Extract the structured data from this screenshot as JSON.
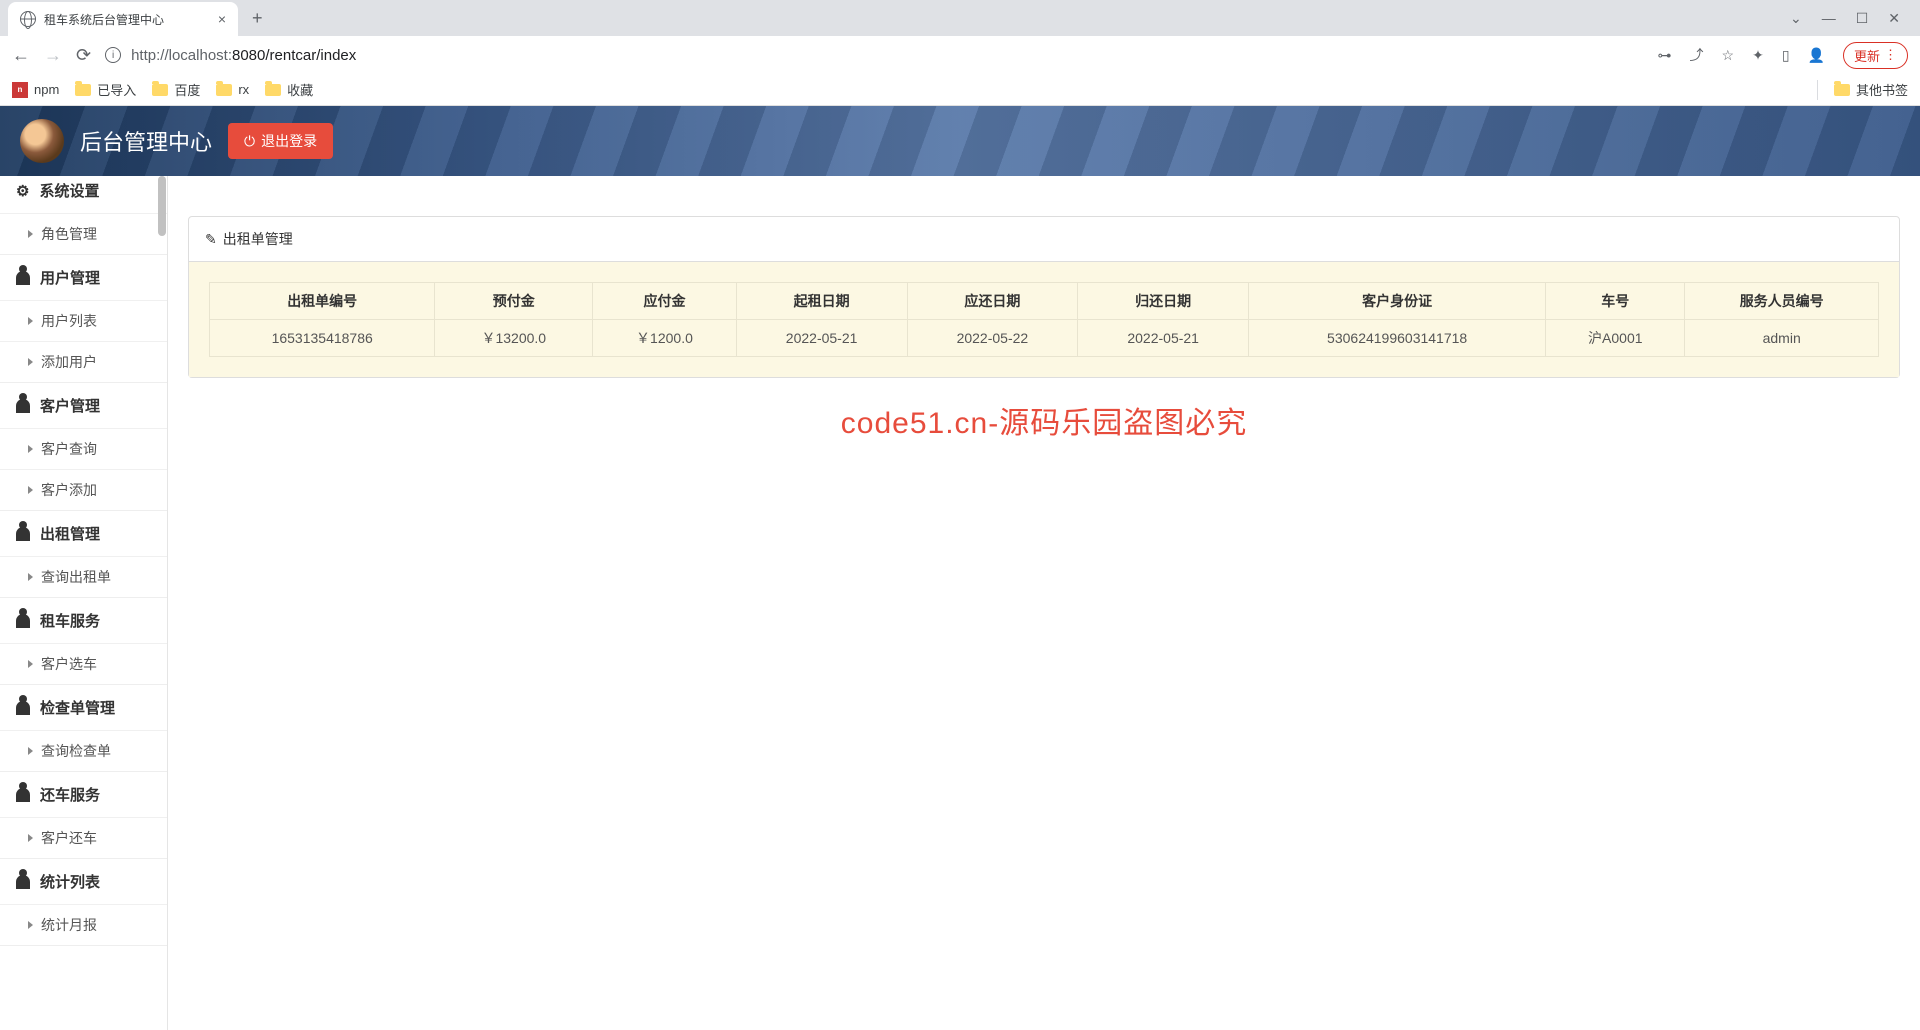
{
  "browser": {
    "tab_title": "租车系统后台管理中心",
    "url_host": "localhost:",
    "url_port": "8080",
    "url_path": "/rentcar/index",
    "url_prefix": "http://",
    "update_label": "更新",
    "bookmarks": [
      "npm",
      "已导入",
      "百度",
      "rx",
      "收藏"
    ],
    "other_bookmarks": "其他书签"
  },
  "header": {
    "title": "后台管理中心",
    "logout": "退出登录"
  },
  "sidebar": {
    "groups": [
      {
        "title": "系统设置",
        "items": [
          "角色管理"
        ]
      },
      {
        "title": "用户管理",
        "items": [
          "用户列表",
          "添加用户"
        ]
      },
      {
        "title": "客户管理",
        "items": [
          "客户查询",
          "客户添加"
        ]
      },
      {
        "title": "出租管理",
        "items": [
          "查询出租单"
        ]
      },
      {
        "title": "租车服务",
        "items": [
          "客户选车"
        ]
      },
      {
        "title": "检查单管理",
        "items": [
          "查询检查单"
        ]
      },
      {
        "title": "还车服务",
        "items": [
          "客户还车"
        ]
      },
      {
        "title": "统计列表",
        "items": [
          "统计月报"
        ]
      }
    ]
  },
  "panel": {
    "title": "出租单管理"
  },
  "table": {
    "headers": [
      "出租单编号",
      "预付金",
      "应付金",
      "起租日期",
      "应还日期",
      "归还日期",
      "客户身份证",
      "车号",
      "服务人员编号"
    ],
    "rows": [
      [
        "1653135418786",
        "￥13200.0",
        "￥1200.0",
        "2022-05-21",
        "2022-05-22",
        "2022-05-21",
        "530624199603141718",
        "沪A0001",
        "admin"
      ]
    ]
  },
  "watermark": "code51.cn-源码乐园盗图必究"
}
